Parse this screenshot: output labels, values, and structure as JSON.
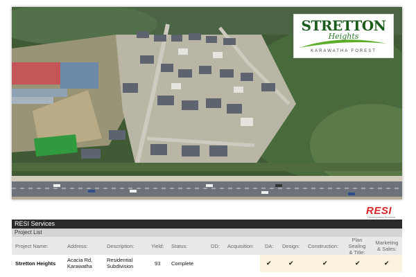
{
  "logo": {
    "title": "STRETTON",
    "script": "Heights",
    "subtitle": "KARAWATHA FOREST"
  },
  "resi": {
    "wordmark": "RESI",
    "tagline": "Development Services"
  },
  "services": {
    "title": "RESI Services",
    "subtitle": "Project List"
  },
  "table": {
    "headers": {
      "project": "Project Name:",
      "address": "Address:",
      "description": "Description:",
      "yield": "Yield:",
      "status": "Status:",
      "dd": "DD:",
      "acquisition": "Acquisition:",
      "da": "DA:",
      "design": "Design:",
      "construction": "Construction:",
      "plan_sealing": [
        "Plan",
        "Sealing",
        "& Title:"
      ],
      "marketing": [
        "Marketing",
        "& Sales:"
      ]
    },
    "row": {
      "project": "Stretton Heights",
      "address": [
        "Acacia Rd,",
        "Karawatha"
      ],
      "description": [
        "Residential",
        "Subdivision"
      ],
      "yield": "93",
      "status": "Complete",
      "check_glyph": "✔"
    }
  },
  "colors": {
    "header_bar": "#2a2a2a",
    "project_bar": "#d4d4d4",
    "column_header_bg": "#e9e9e9",
    "status_highlight": "#fbf2dd",
    "resi_red": "#d7262a",
    "logo_green": "#1c5c1c"
  },
  "icons": {
    "check": "check-icon"
  }
}
